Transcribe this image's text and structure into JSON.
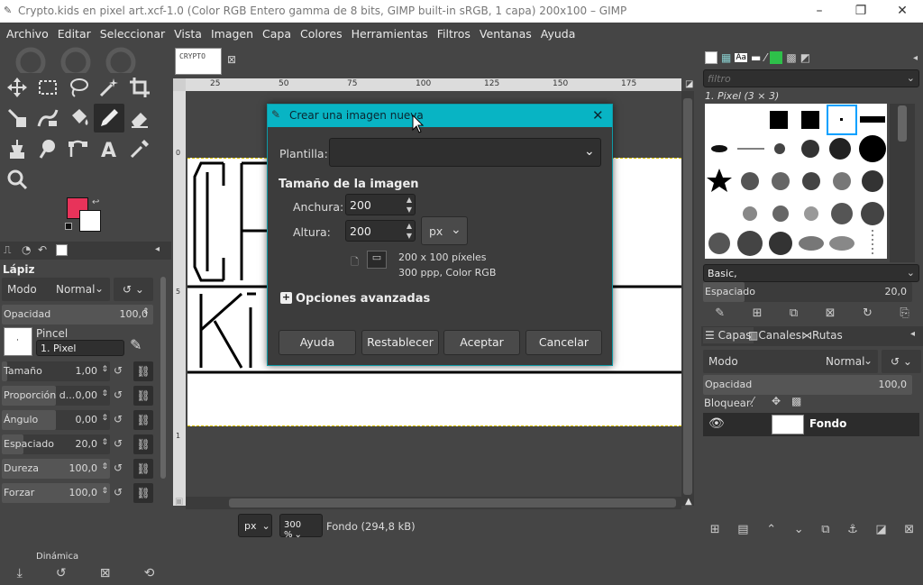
{
  "window": {
    "title": "Crypto.kids en pixel art.xcf-1.0 (Color RGB Entero gamma de 8 bits, GIMP built-in sRGB, 1 capa) 200x100 – GIMP"
  },
  "menu": [
    "Archivo",
    "Editar",
    "Seleccionar",
    "Vista",
    "Imagen",
    "Capa",
    "Colores",
    "Herramientas",
    "Filtros",
    "Ventanas",
    "Ayuda"
  ],
  "tool_options": {
    "title": "Lápiz",
    "mode_label": "Modo",
    "mode_value": "Normal",
    "opacity_label": "Opacidad",
    "opacity_value": "100,0",
    "brush_label": "Pincel",
    "brush_value": "1. Pixel",
    "rows": [
      {
        "label": "Tamaño",
        "value": "1,00",
        "fill": 0.05
      },
      {
        "label": "Proporción d...",
        "value": "0,00",
        "fill": 0.5
      },
      {
        "label": "Ángulo",
        "value": "0,00",
        "fill": 0.5
      },
      {
        "label": "Espaciado",
        "value": "20,0",
        "fill": 0.2
      },
      {
        "label": "Dureza",
        "value": "100,0",
        "fill": 1
      },
      {
        "label": "Forzar",
        "value": "100,0",
        "fill": 1
      }
    ],
    "dynamics_label": "Dinámica"
  },
  "canvas": {
    "ruler_marks": [
      "25",
      "50",
      "75",
      "100",
      "125",
      "150",
      "175"
    ],
    "zoom": "300 %",
    "unit": "px",
    "status": "Fondo (294,8 kB)"
  },
  "dialog": {
    "title": "Crear una imagen nueva",
    "template_label": "Plantilla:",
    "size_heading": "Tamaño de la imagen",
    "width_label": "Anchura:",
    "width_value": "200",
    "height_label": "Altura:",
    "height_value": "200",
    "unit": "px",
    "info_line1": "200 x 100 píxeles",
    "info_line2": "300 ppp, Color RGB",
    "advanced": "Opciones avanzadas",
    "buttons": {
      "help": "Ayuda",
      "reset": "Restablecer",
      "ok": "Aceptar",
      "cancel": "Cancelar"
    }
  },
  "brushes": {
    "filter_placeholder": "filtro",
    "selected": "1. Pixel (3 × 3)",
    "tag": "Basic,",
    "spacing_label": "Espaciado",
    "spacing_value": "20,0"
  },
  "layers": {
    "tabs": [
      "Capas",
      "Canales",
      "Rutas"
    ],
    "mode_label": "Modo",
    "mode_value": "Normal",
    "opacity_label": "Opacidad",
    "opacity_value": "100,0",
    "lock_label": "Bloquear:",
    "layer_name": "Fondo"
  },
  "colors": {
    "fg": "#e8335a",
    "bg": "#ffffff",
    "accent": "#08b4c4"
  }
}
